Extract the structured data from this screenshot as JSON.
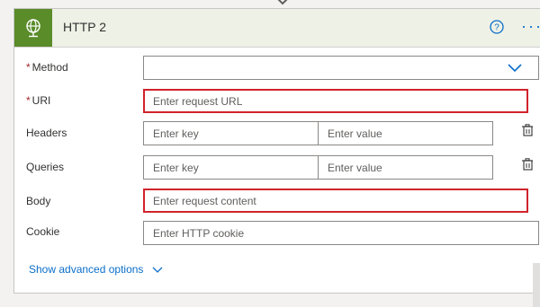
{
  "header": {
    "title": "HTTP 2",
    "icon": "globe-icon",
    "help_icon": "help-icon",
    "more_icon": "more-icon",
    "more_label": "···",
    "accent_color": "#5a8c2a"
  },
  "form": {
    "method": {
      "label": "Method",
      "required": true,
      "value": ""
    },
    "uri": {
      "label": "URI",
      "required": true,
      "placeholder": "Enter request URL"
    },
    "headers": {
      "label": "Headers",
      "key_placeholder": "Enter key",
      "value_placeholder": "Enter value"
    },
    "queries": {
      "label": "Queries",
      "key_placeholder": "Enter key",
      "value_placeholder": "Enter value"
    },
    "body": {
      "label": "Body",
      "placeholder": "Enter request content"
    },
    "cookie": {
      "label": "Cookie",
      "placeholder": "Enter HTTP cookie"
    }
  },
  "footer": {
    "advanced_label": "Show advanced options"
  },
  "colors": {
    "highlight_border": "#d1232a",
    "link": "#0b6ec9",
    "required": "#a4262c"
  }
}
